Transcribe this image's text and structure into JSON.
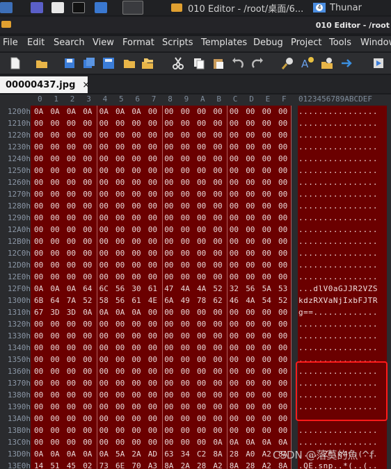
{
  "taskbar": {
    "editor_title": "010 Editor - /root/桌面/6...",
    "thunar_title": "Thunar",
    "thunar_badge": "4"
  },
  "window_title": "010 Editor - /root",
  "menu": [
    "File",
    "Edit",
    "Search",
    "View",
    "Format",
    "Scripts",
    "Templates",
    "Debug",
    "Project",
    "Tools",
    "Window"
  ],
  "toolbar_icons": [
    "new-file-icon",
    "open-folder-icon",
    "save-icon",
    "save-as-icon",
    "save-all-icon",
    "folder-icon",
    "folders-icon",
    "cut-icon",
    "copy-icon",
    "paste-icon",
    "undo-icon",
    "redo-icon",
    "find-icon",
    "replace-icon",
    "find-in-files-icon",
    "goto-icon",
    "run-script-icon"
  ],
  "tab": {
    "label": "00000437.jpg",
    "close": "×"
  },
  "columns": [
    "0",
    "1",
    "2",
    "3",
    "4",
    "5",
    "6",
    "7",
    "8",
    "9",
    "A",
    "B",
    "C",
    "D",
    "E",
    "F"
  ],
  "ascii_header": "0123456789ABCDEF",
  "rows": [
    {
      "addr": "1200h",
      "bytes": [
        "0A",
        "0A",
        "0A",
        "0A",
        "0A",
        "0A",
        "0A",
        "00",
        "00",
        "00",
        "00",
        "00",
        "00",
        "00",
        "00",
        "00"
      ],
      "ascii": "................"
    },
    {
      "addr": "1210h",
      "bytes": [
        "00",
        "00",
        "00",
        "00",
        "00",
        "00",
        "00",
        "00",
        "00",
        "00",
        "00",
        "00",
        "00",
        "00",
        "00",
        "00"
      ],
      "ascii": "................"
    },
    {
      "addr": "1220h",
      "bytes": [
        "00",
        "00",
        "00",
        "00",
        "00",
        "00",
        "00",
        "00",
        "00",
        "00",
        "00",
        "00",
        "00",
        "00",
        "00",
        "00"
      ],
      "ascii": "................"
    },
    {
      "addr": "1230h",
      "bytes": [
        "00",
        "00",
        "00",
        "00",
        "00",
        "00",
        "00",
        "00",
        "00",
        "00",
        "00",
        "00",
        "00",
        "00",
        "00",
        "00"
      ],
      "ascii": "................"
    },
    {
      "addr": "1240h",
      "bytes": [
        "00",
        "00",
        "00",
        "00",
        "00",
        "00",
        "00",
        "00",
        "00",
        "00",
        "00",
        "00",
        "00",
        "00",
        "00",
        "00"
      ],
      "ascii": "................"
    },
    {
      "addr": "1250h",
      "bytes": [
        "00",
        "00",
        "00",
        "00",
        "00",
        "00",
        "00",
        "00",
        "00",
        "00",
        "00",
        "00",
        "00",
        "00",
        "00",
        "00"
      ],
      "ascii": "................"
    },
    {
      "addr": "1260h",
      "bytes": [
        "00",
        "00",
        "00",
        "00",
        "00",
        "00",
        "00",
        "00",
        "00",
        "00",
        "00",
        "00",
        "00",
        "00",
        "00",
        "00"
      ],
      "ascii": "................"
    },
    {
      "addr": "1270h",
      "bytes": [
        "00",
        "00",
        "00",
        "00",
        "00",
        "00",
        "00",
        "00",
        "00",
        "00",
        "00",
        "00",
        "00",
        "00",
        "00",
        "00"
      ],
      "ascii": "................"
    },
    {
      "addr": "1280h",
      "bytes": [
        "00",
        "00",
        "00",
        "00",
        "00",
        "00",
        "00",
        "00",
        "00",
        "00",
        "00",
        "00",
        "00",
        "00",
        "00",
        "00"
      ],
      "ascii": "................"
    },
    {
      "addr": "1290h",
      "bytes": [
        "00",
        "00",
        "00",
        "00",
        "00",
        "00",
        "00",
        "00",
        "00",
        "00",
        "00",
        "00",
        "00",
        "00",
        "00",
        "00"
      ],
      "ascii": "................"
    },
    {
      "addr": "12A0h",
      "bytes": [
        "00",
        "00",
        "00",
        "00",
        "00",
        "00",
        "00",
        "00",
        "00",
        "00",
        "00",
        "00",
        "00",
        "00",
        "00",
        "00"
      ],
      "ascii": "................"
    },
    {
      "addr": "12B0h",
      "bytes": [
        "00",
        "00",
        "00",
        "00",
        "00",
        "00",
        "00",
        "00",
        "00",
        "00",
        "00",
        "00",
        "00",
        "00",
        "00",
        "00"
      ],
      "ascii": "................"
    },
    {
      "addr": "12C0h",
      "bytes": [
        "00",
        "00",
        "00",
        "00",
        "00",
        "00",
        "00",
        "00",
        "00",
        "00",
        "00",
        "00",
        "00",
        "00",
        "00",
        "00"
      ],
      "ascii": "................"
    },
    {
      "addr": "12D0h",
      "bytes": [
        "00",
        "00",
        "00",
        "00",
        "00",
        "00",
        "00",
        "00",
        "00",
        "00",
        "00",
        "00",
        "00",
        "00",
        "00",
        "00"
      ],
      "ascii": "................"
    },
    {
      "addr": "12E0h",
      "bytes": [
        "00",
        "00",
        "00",
        "00",
        "00",
        "00",
        "00",
        "00",
        "00",
        "00",
        "00",
        "00",
        "00",
        "00",
        "00",
        "00"
      ],
      "ascii": "................"
    },
    {
      "addr": "12F0h",
      "bytes": [
        "0A",
        "0A",
        "0A",
        "64",
        "6C",
        "56",
        "30",
        "61",
        "47",
        "4A",
        "4A",
        "52",
        "32",
        "56",
        "5A",
        "53"
      ],
      "ascii": "...dlV0aGJJR2VZS"
    },
    {
      "addr": "1300h",
      "bytes": [
        "6B",
        "64",
        "7A",
        "52",
        "58",
        "56",
        "61",
        "4E",
        "6A",
        "49",
        "78",
        "62",
        "46",
        "4A",
        "54",
        "52"
      ],
      "ascii": "kdzRXVaNjIxbFJTR"
    },
    {
      "addr": "1310h",
      "bytes": [
        "67",
        "3D",
        "3D",
        "0A",
        "0A",
        "0A",
        "0A",
        "00",
        "00",
        "00",
        "00",
        "00",
        "00",
        "00",
        "00",
        "00"
      ],
      "ascii": "g==............."
    },
    {
      "addr": "1320h",
      "bytes": [
        "00",
        "00",
        "00",
        "00",
        "00",
        "00",
        "00",
        "00",
        "00",
        "00",
        "00",
        "00",
        "00",
        "00",
        "00",
        "00"
      ],
      "ascii": "................"
    },
    {
      "addr": "1330h",
      "bytes": [
        "00",
        "00",
        "00",
        "00",
        "00",
        "00",
        "00",
        "00",
        "00",
        "00",
        "00",
        "00",
        "00",
        "00",
        "00",
        "00"
      ],
      "ascii": "................"
    },
    {
      "addr": "1340h",
      "bytes": [
        "00",
        "00",
        "00",
        "00",
        "00",
        "00",
        "00",
        "00",
        "00",
        "00",
        "00",
        "00",
        "00",
        "00",
        "00",
        "00"
      ],
      "ascii": "................"
    },
    {
      "addr": "1350h",
      "bytes": [
        "00",
        "00",
        "00",
        "00",
        "00",
        "00",
        "00",
        "00",
        "00",
        "00",
        "00",
        "00",
        "00",
        "00",
        "00",
        "00"
      ],
      "ascii": "................"
    },
    {
      "addr": "1360h",
      "bytes": [
        "00",
        "00",
        "00",
        "00",
        "00",
        "00",
        "00",
        "00",
        "00",
        "00",
        "00",
        "00",
        "00",
        "00",
        "00",
        "00"
      ],
      "ascii": "................"
    },
    {
      "addr": "1370h",
      "bytes": [
        "00",
        "00",
        "00",
        "00",
        "00",
        "00",
        "00",
        "00",
        "00",
        "00",
        "00",
        "00",
        "00",
        "00",
        "00",
        "00"
      ],
      "ascii": "................"
    },
    {
      "addr": "1380h",
      "bytes": [
        "00",
        "00",
        "00",
        "00",
        "00",
        "00",
        "00",
        "00",
        "00",
        "00",
        "00",
        "00",
        "00",
        "00",
        "00",
        "00"
      ],
      "ascii": "................"
    },
    {
      "addr": "1390h",
      "bytes": [
        "00",
        "00",
        "00",
        "00",
        "00",
        "00",
        "00",
        "00",
        "00",
        "00",
        "00",
        "00",
        "00",
        "00",
        "00",
        "00"
      ],
      "ascii": "................"
    },
    {
      "addr": "13A0h",
      "bytes": [
        "00",
        "00",
        "00",
        "00",
        "00",
        "00",
        "00",
        "00",
        "00",
        "00",
        "00",
        "00",
        "00",
        "00",
        "00",
        "00"
      ],
      "ascii": "................"
    },
    {
      "addr": "13B0h",
      "bytes": [
        "00",
        "00",
        "00",
        "00",
        "00",
        "00",
        "00",
        "00",
        "00",
        "00",
        "00",
        "00",
        "00",
        "00",
        "00",
        "00"
      ],
      "ascii": "................"
    },
    {
      "addr": "13C0h",
      "bytes": [
        "00",
        "00",
        "00",
        "00",
        "00",
        "00",
        "00",
        "00",
        "00",
        "00",
        "00",
        "0A",
        "0A",
        "0A",
        "0A",
        "0A"
      ],
      "ascii": "................"
    },
    {
      "addr": "13D0h",
      "bytes": [
        "0A",
        "0A",
        "0A",
        "0A",
        "0A",
        "5A",
        "2A",
        "AD",
        "63",
        "34",
        "C2",
        "8A",
        "28",
        "A0",
        "A2",
        "8A"
      ],
      "ascii": ".....Z*.c4..(..."
    },
    {
      "addr": "13E0h",
      "bytes": [
        "14",
        "51",
        "45",
        "02",
        "73",
        "6E",
        "70",
        "A3",
        "8A",
        "2A",
        "28",
        "A2",
        "8A",
        "28",
        "A2",
        "8A"
      ],
      "ascii": ".QE.snp..*(..(.."
    }
  ],
  "watermark": "CSDN @落莫的魚 ^f",
  "colors": {
    "hex_bg": "#6b0000",
    "highlight": "#ff1a1a"
  }
}
